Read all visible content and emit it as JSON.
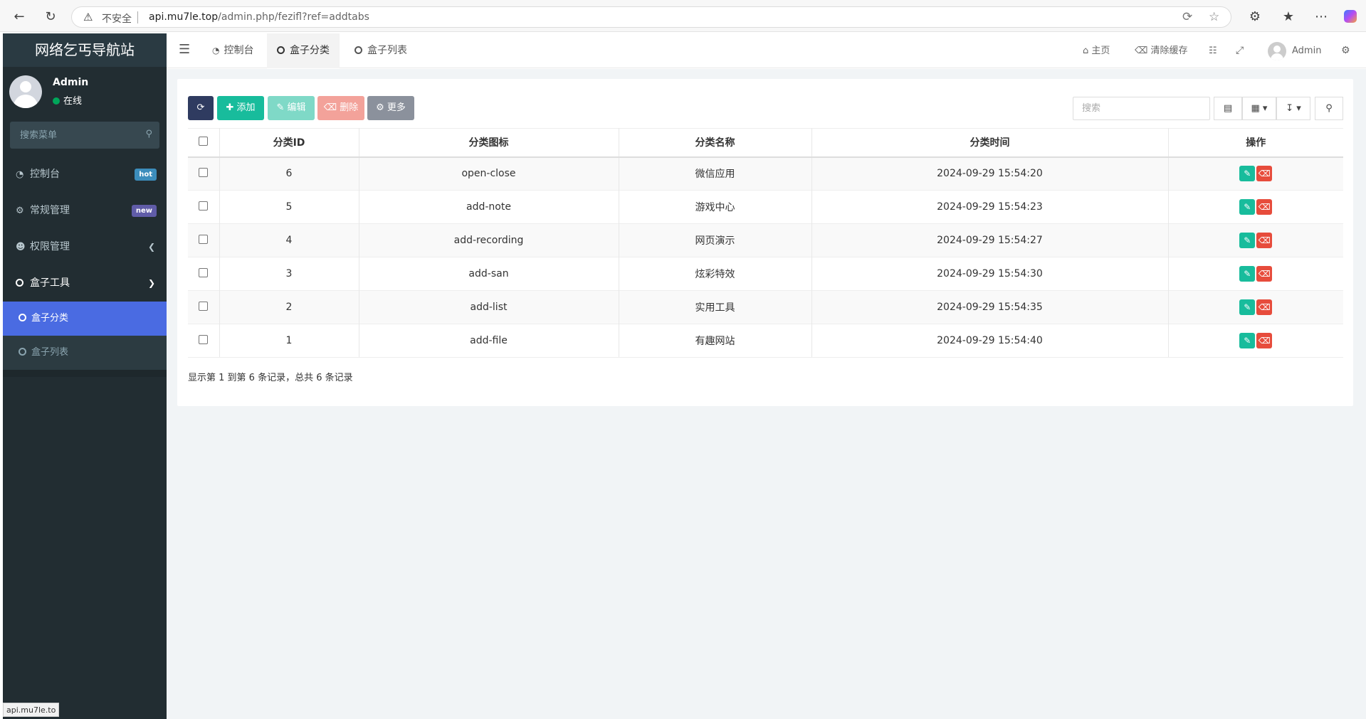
{
  "browser": {
    "insecure_label": "不安全",
    "url_host": "api.mu7le.top",
    "url_path": "/admin.php/fezifl?ref=addtabs",
    "status_url": "api.mu7le.to"
  },
  "sidebar": {
    "logo": "网络乞丐导航站",
    "user_name": "Admin",
    "user_status": "在线",
    "search_placeholder": "搜索菜单",
    "items": [
      {
        "label": "控制台",
        "icon": "dashboard-icon",
        "badge": "hot"
      },
      {
        "label": "常规管理",
        "icon": "cogs-icon",
        "badge": "new"
      },
      {
        "label": "权限管理",
        "icon": "group-icon"
      },
      {
        "label": "盒子工具",
        "icon": "circle-icon"
      }
    ],
    "subitems": [
      {
        "label": "盒子分类",
        "active": true
      },
      {
        "label": "盒子列表",
        "active": false
      }
    ]
  },
  "topbar": {
    "tabs": [
      {
        "label": "控制台"
      },
      {
        "label": "盒子分类"
      },
      {
        "label": "盒子列表"
      }
    ],
    "home": "主页",
    "clear_cache": "清除缓存",
    "admin": "Admin"
  },
  "toolbar": {
    "add": "添加",
    "edit": "编辑",
    "delete": "删除",
    "more": "更多",
    "search_placeholder": "搜索"
  },
  "table": {
    "columns": [
      "分类ID",
      "分类图标",
      "分类名称",
      "分类时间",
      "操作"
    ],
    "rows": [
      {
        "id": "6",
        "icon": "open-close",
        "name": "微信应用",
        "time": "2024-09-29 15:54:20"
      },
      {
        "id": "5",
        "icon": "add-note",
        "name": "游戏中心",
        "time": "2024-09-29 15:54:23"
      },
      {
        "id": "4",
        "icon": "add-recording",
        "name": "网页演示",
        "time": "2024-09-29 15:54:27"
      },
      {
        "id": "3",
        "icon": "add-san",
        "name": "炫彩特效",
        "time": "2024-09-29 15:54:30"
      },
      {
        "id": "2",
        "icon": "add-list",
        "name": "实用工具",
        "time": "2024-09-29 15:54:35"
      },
      {
        "id": "1",
        "icon": "add-file",
        "name": "有趣网站",
        "time": "2024-09-29 15:54:40"
      }
    ]
  },
  "pagination": {
    "summary": "显示第 1 到第 6 条记录，总共 6 条记录"
  }
}
